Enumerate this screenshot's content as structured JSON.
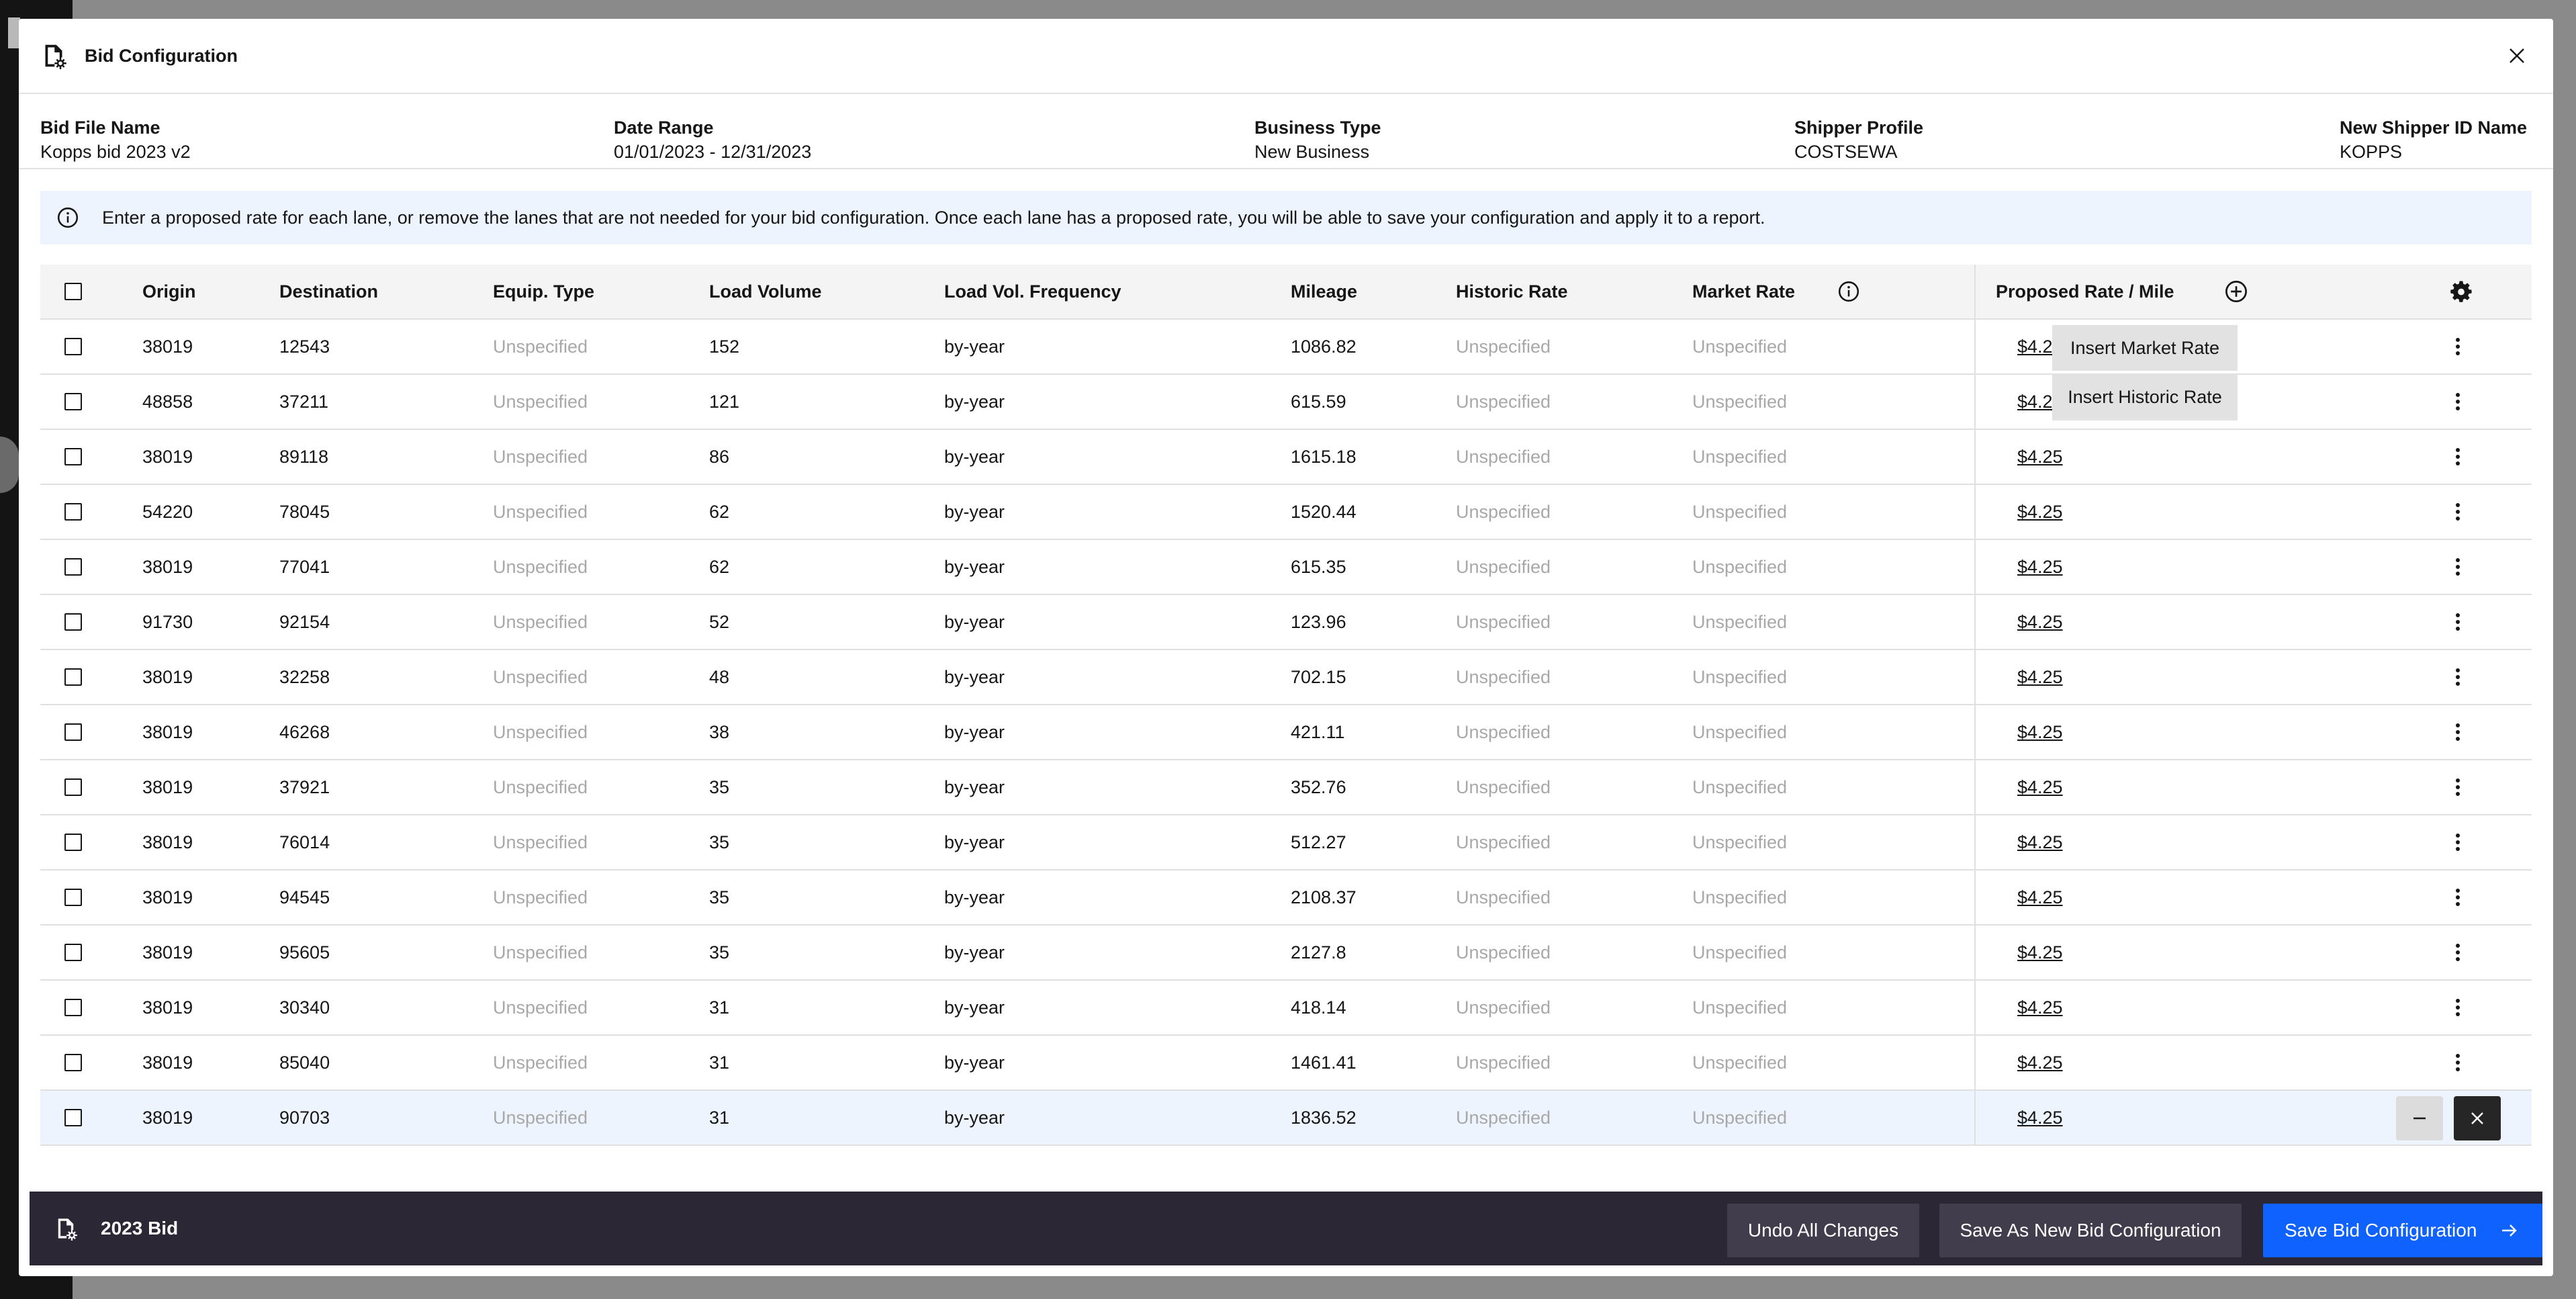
{
  "modal": {
    "title": "Bid Configuration"
  },
  "info": [
    {
      "label": "Bid File Name",
      "value": "Kopps bid 2023 v2"
    },
    {
      "label": "Date Range",
      "value": "01/01/2023 - 12/31/2023"
    },
    {
      "label": "Business Type",
      "value": "New Business"
    },
    {
      "label": "Shipper Profile",
      "value": "COSTSEWA"
    },
    {
      "label": "New Shipper ID Name",
      "value": "KOPPS"
    }
  ],
  "notice": {
    "text": "Enter a proposed rate for each lane, or remove the lanes that are not needed for your bid configuration. Once each lane has a proposed rate, you will be able to save your configuration and apply it to a report."
  },
  "table": {
    "headers": {
      "origin": "Origin",
      "destination": "Destination",
      "equip": "Equip. Type",
      "volume": "Load Volume",
      "frequency": "Load Vol. Frequency",
      "mileage": "Mileage",
      "historic": "Historic Rate",
      "market": "Market Rate",
      "proposed": "Proposed Rate / Mile"
    },
    "rows": [
      {
        "origin": "38019",
        "destination": "12543",
        "equip": "Unspecified",
        "volume": "152",
        "frequency": "by-year",
        "mileage": "1086.82",
        "historic": "Unspecified",
        "market": "Unspecified",
        "proposed": "$4.25"
      },
      {
        "origin": "48858",
        "destination": "37211",
        "equip": "Unspecified",
        "volume": "121",
        "frequency": "by-year",
        "mileage": "615.59",
        "historic": "Unspecified",
        "market": "Unspecified",
        "proposed": "$4.25"
      },
      {
        "origin": "38019",
        "destination": "89118",
        "equip": "Unspecified",
        "volume": "86",
        "frequency": "by-year",
        "mileage": "1615.18",
        "historic": "Unspecified",
        "market": "Unspecified",
        "proposed": "$4.25"
      },
      {
        "origin": "54220",
        "destination": "78045",
        "equip": "Unspecified",
        "volume": "62",
        "frequency": "by-year",
        "mileage": "1520.44",
        "historic": "Unspecified",
        "market": "Unspecified",
        "proposed": "$4.25"
      },
      {
        "origin": "38019",
        "destination": "77041",
        "equip": "Unspecified",
        "volume": "62",
        "frequency": "by-year",
        "mileage": "615.35",
        "historic": "Unspecified",
        "market": "Unspecified",
        "proposed": "$4.25"
      },
      {
        "origin": "91730",
        "destination": "92154",
        "equip": "Unspecified",
        "volume": "52",
        "frequency": "by-year",
        "mileage": "123.96",
        "historic": "Unspecified",
        "market": "Unspecified",
        "proposed": "$4.25"
      },
      {
        "origin": "38019",
        "destination": "32258",
        "equip": "Unspecified",
        "volume": "48",
        "frequency": "by-year",
        "mileage": "702.15",
        "historic": "Unspecified",
        "market": "Unspecified",
        "proposed": "$4.25"
      },
      {
        "origin": "38019",
        "destination": "46268",
        "equip": "Unspecified",
        "volume": "38",
        "frequency": "by-year",
        "mileage": "421.11",
        "historic": "Unspecified",
        "market": "Unspecified",
        "proposed": "$4.25"
      },
      {
        "origin": "38019",
        "destination": "37921",
        "equip": "Unspecified",
        "volume": "35",
        "frequency": "by-year",
        "mileage": "352.76",
        "historic": "Unspecified",
        "market": "Unspecified",
        "proposed": "$4.25"
      },
      {
        "origin": "38019",
        "destination": "76014",
        "equip": "Unspecified",
        "volume": "35",
        "frequency": "by-year",
        "mileage": "512.27",
        "historic": "Unspecified",
        "market": "Unspecified",
        "proposed": "$4.25"
      },
      {
        "origin": "38019",
        "destination": "94545",
        "equip": "Unspecified",
        "volume": "35",
        "frequency": "by-year",
        "mileage": "2108.37",
        "historic": "Unspecified",
        "market": "Unspecified",
        "proposed": "$4.25"
      },
      {
        "origin": "38019",
        "destination": "95605",
        "equip": "Unspecified",
        "volume": "35",
        "frequency": "by-year",
        "mileage": "2127.8",
        "historic": "Unspecified",
        "market": "Unspecified",
        "proposed": "$4.25"
      },
      {
        "origin": "38019",
        "destination": "30340",
        "equip": "Unspecified",
        "volume": "31",
        "frequency": "by-year",
        "mileage": "418.14",
        "historic": "Unspecified",
        "market": "Unspecified",
        "proposed": "$4.25"
      },
      {
        "origin": "38019",
        "destination": "85040",
        "equip": "Unspecified",
        "volume": "31",
        "frequency": "by-year",
        "mileage": "1461.41",
        "historic": "Unspecified",
        "market": "Unspecified",
        "proposed": "$4.25"
      },
      {
        "origin": "38019",
        "destination": "90703",
        "equip": "Unspecified",
        "volume": "31",
        "frequency": "by-year",
        "mileage": "1836.52",
        "historic": "Unspecified",
        "market": "Unspecified",
        "proposed": "$4.25"
      }
    ]
  },
  "rate_menu": {
    "items": [
      "Insert Market Rate",
      "Insert Historic Rate"
    ]
  },
  "footer": {
    "title": "2023 Bid",
    "undo_label": "Undo All Changes",
    "save_new_label": "Save As New Bid Configuration",
    "save_label": "Save Bid Configuration"
  },
  "icons": {
    "header": "file-settings-icon",
    "close": "close-icon",
    "notice": "information-icon",
    "market_info": "information-icon",
    "add_rate": "add-circle-icon",
    "settings": "gear-icon",
    "row_actions": "overflow-menu-icon",
    "footer": "file-settings-icon",
    "save_arrow": "arrow-right-icon"
  },
  "colors": {
    "primary": "#0f62fe",
    "footer_bg": "#2b2734",
    "notice_bg": "#eef4fd"
  }
}
